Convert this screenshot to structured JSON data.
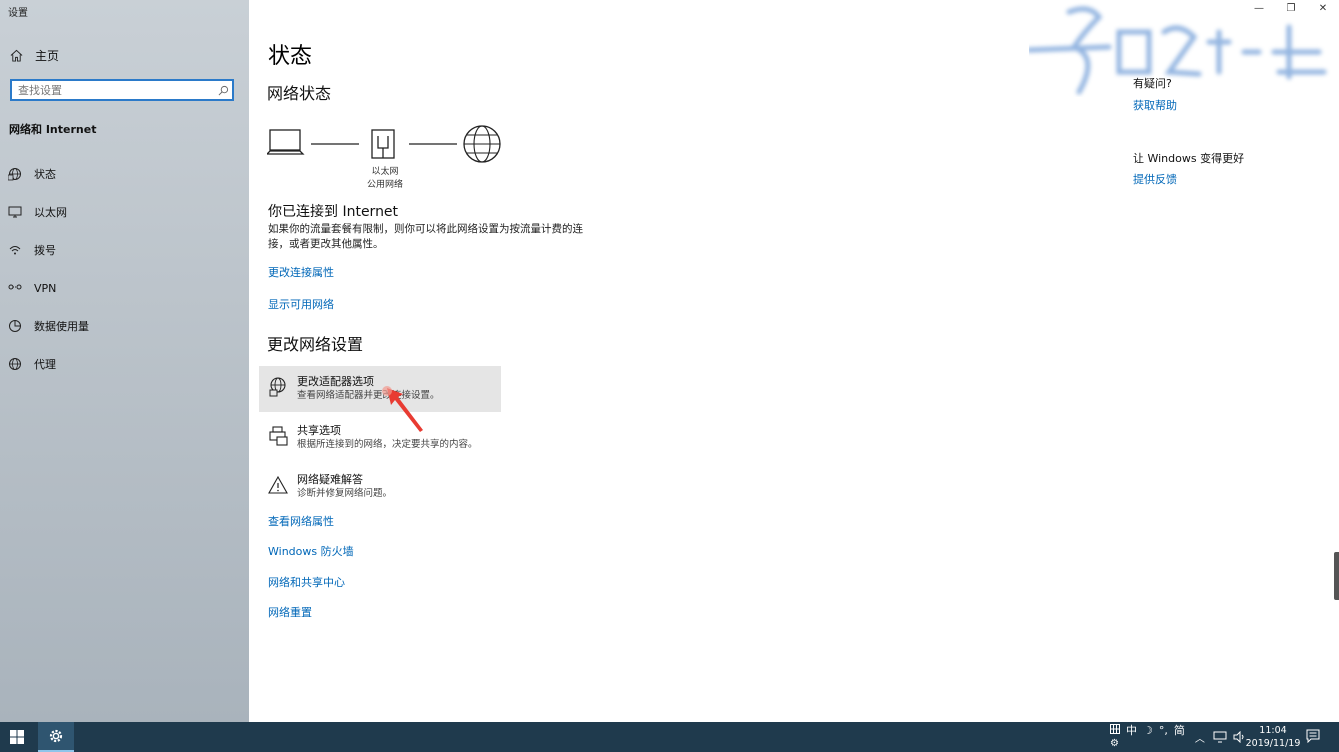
{
  "window": {
    "title": "设置",
    "controls": {
      "minimize": "—",
      "restore": "❐",
      "close": "✕"
    }
  },
  "sidebar": {
    "home_label": "主页",
    "search_placeholder": "查找设置",
    "section_title": "网络和 Internet",
    "items": [
      {
        "label": "状态",
        "icon": "globe-status-icon"
      },
      {
        "label": "以太网",
        "icon": "ethernet-monitor-icon"
      },
      {
        "label": "拨号",
        "icon": "wifi-dial-icon"
      },
      {
        "label": "VPN",
        "icon": "vpn-icon"
      },
      {
        "label": "数据使用量",
        "icon": "data-usage-icon"
      },
      {
        "label": "代理",
        "icon": "globe-proxy-icon"
      }
    ]
  },
  "main": {
    "title": "状态",
    "network_status_heading": "网络状态",
    "diagram": {
      "label_line1": "以太网",
      "label_line2": "公用网络"
    },
    "connected_title": "你已连接到 Internet",
    "connected_desc": "如果你的流量套餐有限制，则你可以将此网络设置为按流量计费的连接，或者更改其他属性。",
    "link_change_props": "更改连接属性",
    "link_show_networks": "显示可用网络",
    "change_settings_heading": "更改网络设置",
    "options": [
      {
        "title": "更改适配器选项",
        "desc": "查看网络适配器并更改连接设置。",
        "icon": "adapter-globe-icon"
      },
      {
        "title": "共享选项",
        "desc": "根据所连接到的网络，决定要共享的内容。",
        "icon": "sharing-printer-icon"
      },
      {
        "title": "网络疑难解答",
        "desc": "诊断并修复网络问题。",
        "icon": "warning-icon"
      }
    ],
    "links": [
      "查看网络属性",
      "Windows 防火墙",
      "网络和共享中心",
      "网络重置"
    ]
  },
  "right_panel": {
    "question": "有疑问?",
    "get_help": "获取帮助",
    "make_better": "让 Windows 变得更好",
    "feedback": "提供反馈"
  },
  "taskbar": {
    "ime_top": [
      "中",
      "°,",
      "简"
    ],
    "time": "11:04",
    "date": "2019/11/19"
  },
  "colors": {
    "accent": "#0067b8",
    "taskbar": "#1f3a4d",
    "sidebar": "#bcc4cb",
    "hover": "#e5e5e5"
  }
}
